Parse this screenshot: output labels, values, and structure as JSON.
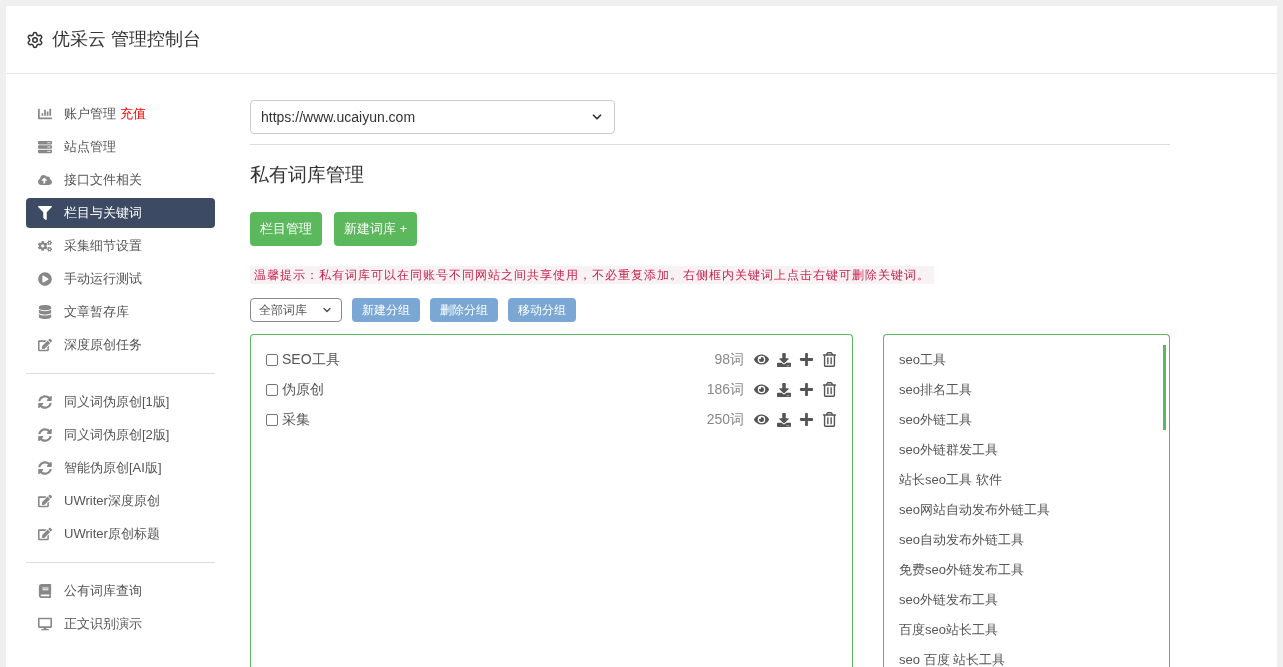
{
  "header": {
    "title": "优采云 管理控制台"
  },
  "sidebar": {
    "groups": [
      [
        {
          "label": "账户管理",
          "badge": "充值",
          "selected": false
        },
        {
          "label": "站点管理",
          "selected": false
        },
        {
          "label": "接口文件相关",
          "selected": false
        },
        {
          "label": "栏目与关键词",
          "selected": true
        },
        {
          "label": "采集细节设置",
          "selected": false
        },
        {
          "label": "手动运行测试",
          "selected": false
        },
        {
          "label": "文章暂存库",
          "selected": false
        },
        {
          "label": "深度原创任务",
          "selected": false
        }
      ],
      [
        {
          "label": "同义词伪原创[1版]",
          "selected": false
        },
        {
          "label": "同义词伪原创[2版]",
          "selected": false
        },
        {
          "label": "智能伪原创[AI版]",
          "selected": false
        },
        {
          "label": "UWriter深度原创",
          "selected": false
        },
        {
          "label": "UWriter原创标题",
          "selected": false
        }
      ],
      [
        {
          "label": "公有词库查询",
          "selected": false
        },
        {
          "label": "正文识别演示",
          "selected": false
        }
      ]
    ]
  },
  "site_select": {
    "value": "https://www.ucaiyun.com"
  },
  "section_title": "私有词库管理",
  "actions": [
    {
      "label": "栏目管理"
    },
    {
      "label": "新建词库 +"
    }
  ],
  "tip": "温馨提示：私有词库可以在同账号不同网站之间共享使用，不必重复添加。右侧框内关键词上点击右键可删除关键词。",
  "toolbar": {
    "filter": {
      "value": "全部词库"
    },
    "buttons": [
      {
        "label": "新建分组",
        "disabled": true
      },
      {
        "label": "删除分组",
        "disabled": true
      },
      {
        "label": "移动分组",
        "disabled": true
      }
    ]
  },
  "libraries": [
    {
      "name": "SEO工具",
      "count": "98词",
      "checked": false
    },
    {
      "name": "伪原创",
      "count": "186词",
      "checked": false
    },
    {
      "name": "采集",
      "count": "250词",
      "checked": false
    }
  ],
  "keywords": [
    "seo工具",
    "seo排名工具",
    "seo外链工具",
    "seo外链群发工具",
    "站长seo工具 软件",
    "seo网站自动发布外链工具",
    "seo自动发布外链工具",
    "免费seo外链发布工具",
    "seo外链发布工具",
    "百度seo站长工具",
    "seo 百度 站长工具"
  ]
}
